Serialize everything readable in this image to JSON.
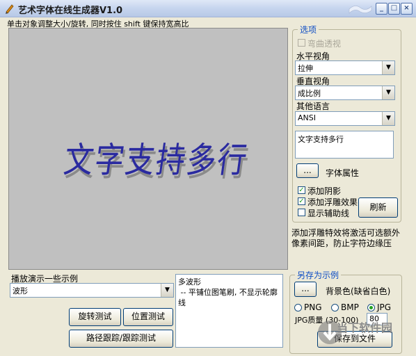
{
  "window": {
    "title": "艺术字体在线生成器V1.0",
    "hint": "单击对象调整大小/旋转, 同时按住 shift 键保持宽高比"
  },
  "canvas": {
    "art_text": "文字支持多行"
  },
  "options": {
    "legend": "选项",
    "curve_label": "弯曲透视",
    "horizontal_label": "水平视角",
    "horizontal_value": "拉伸",
    "vertical_label": "垂直视角",
    "vertical_value": "成比例",
    "other_lang_label": "其他语言",
    "other_lang_value": "ANSI",
    "text_value": "文字支持多行",
    "font_button": "...",
    "font_label": "字体属性",
    "shadow_label": "添加阴影",
    "emboss_label": "添加浮雕效果",
    "guide_label": "显示辅助线",
    "refresh_button": "刷新",
    "note": "添加浮雕特效将激活可选额外像素间距，防止字符边缘压"
  },
  "demo": {
    "label": "播放演示一些示例",
    "select_value": "波形",
    "description": "多波形\n -- 平铺位图笔刷, 不显示轮廓线",
    "rotate_button": "旋转测试",
    "position_button": "位置测试",
    "path_button": "路径跟踪/跟踪测试"
  },
  "save": {
    "legend": "另存为示例",
    "bg_button": "...",
    "bg_label": "背景色(缺省白色)",
    "png": "PNG",
    "bmp": "BMP",
    "jpg": "JPG",
    "quality_label": "JPG质量 (30-100)",
    "quality_value": "80",
    "save_button": "保存到文件"
  },
  "watermark": {
    "text": "当下软件园"
  },
  "colors": {
    "accent": "#0b4bc4",
    "check": "#21a121",
    "art": "#2a2aa0"
  }
}
